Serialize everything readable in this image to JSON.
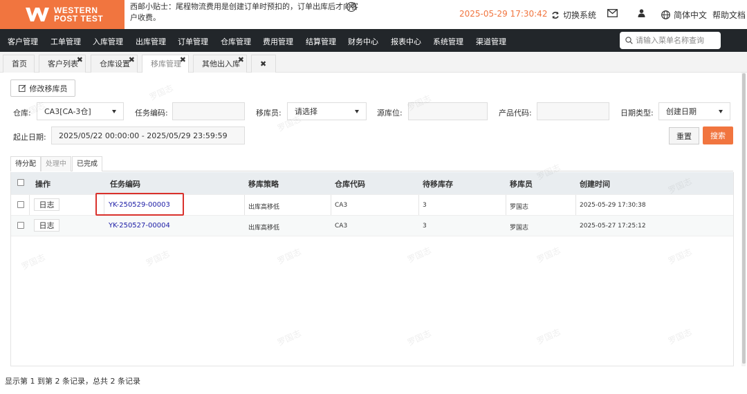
{
  "header": {
    "logo_line1": "WESTERN",
    "logo_line2": "POST TEST",
    "tip": "西邮小贴士：尾程物流费用是创建订单时预扣的，订单出库后才向客户收费。",
    "datetime": "2025-05-29 17:30:42",
    "switch_system": "切换系统",
    "language": "简体中文",
    "help_docs": "帮助文档",
    "accent_color": "#f1753f"
  },
  "nav": {
    "items": [
      "客户管理",
      "工单管理",
      "入库管理",
      "出库管理",
      "订单管理",
      "仓库管理",
      "费用管理",
      "结算管理",
      "财务中心",
      "报表中心",
      "系统管理",
      "渠道管理"
    ],
    "search_placeholder": "请输入菜单名称查询"
  },
  "tabs": [
    {
      "label": "首页"
    },
    {
      "label": "客户列表"
    },
    {
      "label": "仓库设置"
    },
    {
      "label": "移库管理"
    },
    {
      "label": "其他出入库"
    }
  ],
  "toolbar": {
    "modify_button": "修改移库员"
  },
  "filters": {
    "warehouse_label": "仓库:",
    "warehouse_value": "CA3[CA-3仓]",
    "task_code_label": "任务编码:",
    "task_code_value": "",
    "mover_label": "移库员:",
    "mover_value": "请选择",
    "source_location_label": "源库位:",
    "source_location_value": "",
    "product_code_label": "产品代码:",
    "product_code_value": "",
    "date_type_label": "日期类型:",
    "date_type_value": "创建日期",
    "date_range_label": "起止日期:",
    "date_range_value": "2025/05/22 00:00:00 - 2025/05/29 23:59:59",
    "reset_button": "重置",
    "search_button": "搜索"
  },
  "status_tabs": [
    "待分配",
    "处理中",
    "已完成"
  ],
  "table": {
    "headers": [
      "操作",
      "任务编码",
      "移库策略",
      "仓库代码",
      "待移库存",
      "移库员",
      "创建时间"
    ],
    "rows": [
      {
        "action": "日志",
        "task_code": "YK-250529-00003",
        "strategy": "出库高移低",
        "warehouse": "CA3",
        "pending": "3",
        "mover": "罗国志",
        "created": "2025-05-29 17:30:38"
      },
      {
        "action": "日志",
        "task_code": "YK-250527-00004",
        "strategy": "出库高移低",
        "warehouse": "CA3",
        "pending": "3",
        "mover": "罗国志",
        "created": "2025-05-27 17:25:12"
      }
    ]
  },
  "footer": {
    "summary": "显示第 1 到第 2 条记录，总共 2 条记录"
  },
  "watermark": "罗国志"
}
